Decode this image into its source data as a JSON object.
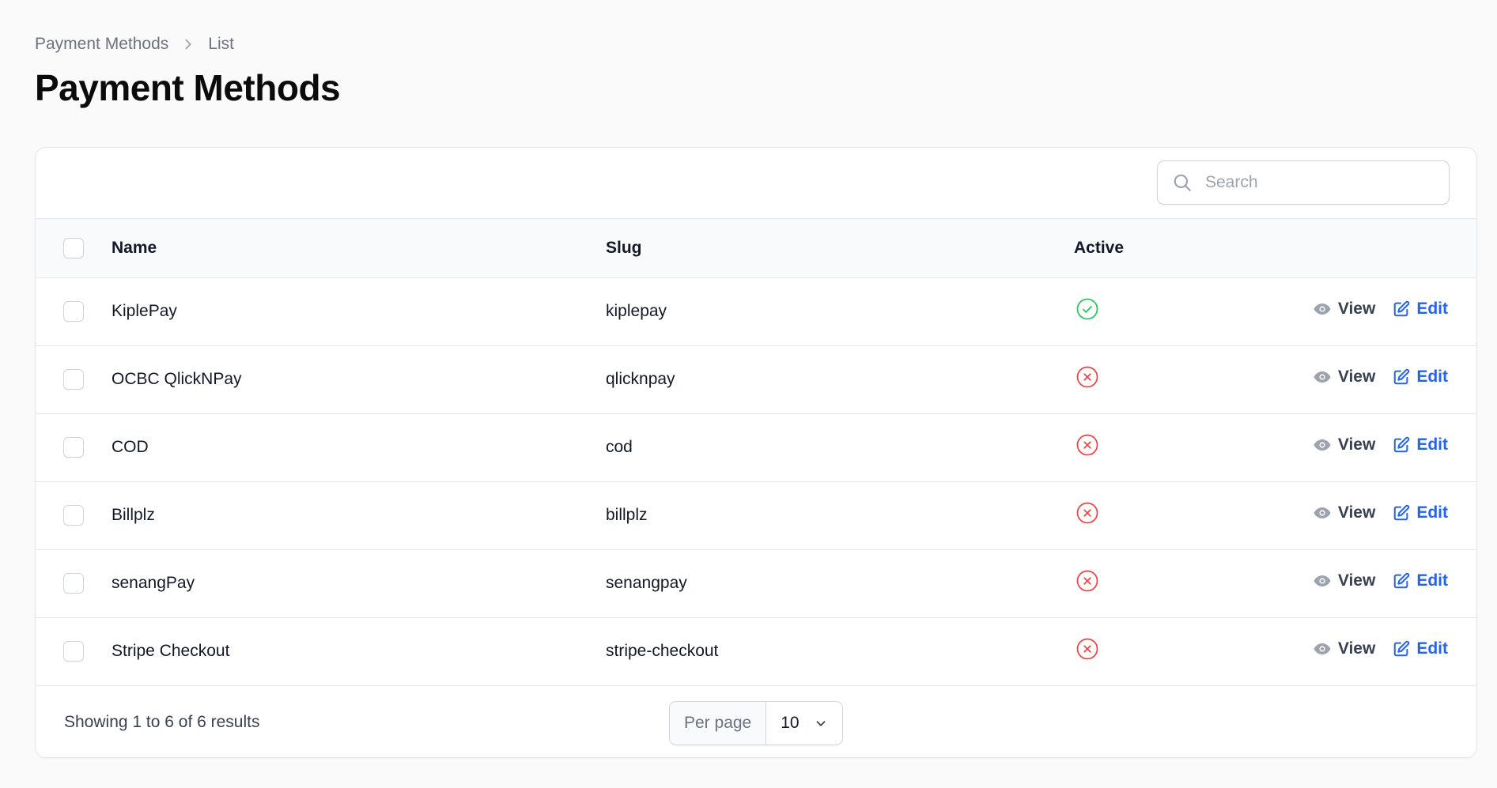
{
  "breadcrumb": {
    "parent": "Payment Methods",
    "current": "List"
  },
  "page_title": "Payment Methods",
  "search": {
    "placeholder": "Search",
    "value": ""
  },
  "table": {
    "columns": {
      "name": "Name",
      "slug": "Slug",
      "active": "Active"
    },
    "actions": {
      "view": "View",
      "edit": "Edit"
    },
    "rows": [
      {
        "name": "KiplePay",
        "slug": "kiplepay",
        "active": true
      },
      {
        "name": "OCBC QlickNPay",
        "slug": "qlicknpay",
        "active": false
      },
      {
        "name": "COD",
        "slug": "cod",
        "active": false
      },
      {
        "name": "Billplz",
        "slug": "billplz",
        "active": false
      },
      {
        "name": "senangPay",
        "slug": "senangpay",
        "active": false
      },
      {
        "name": "Stripe Checkout",
        "slug": "stripe-checkout",
        "active": false
      }
    ]
  },
  "pagination": {
    "summary": "Showing 1 to 6 of 6 results",
    "per_page_label": "Per page",
    "per_page_value": "10"
  },
  "colors": {
    "active_true": "#22c55e",
    "active_false": "#ef4444",
    "edit_link": "#2563eb",
    "view_link": "#374151"
  },
  "icons": {
    "breadcrumb_separator": "chevron-right-icon",
    "search": "search-icon",
    "active_true": "check-circle-icon",
    "active_false": "x-circle-icon",
    "view": "eye-icon",
    "edit": "pencil-square-icon",
    "select": "chevron-down-icon"
  }
}
